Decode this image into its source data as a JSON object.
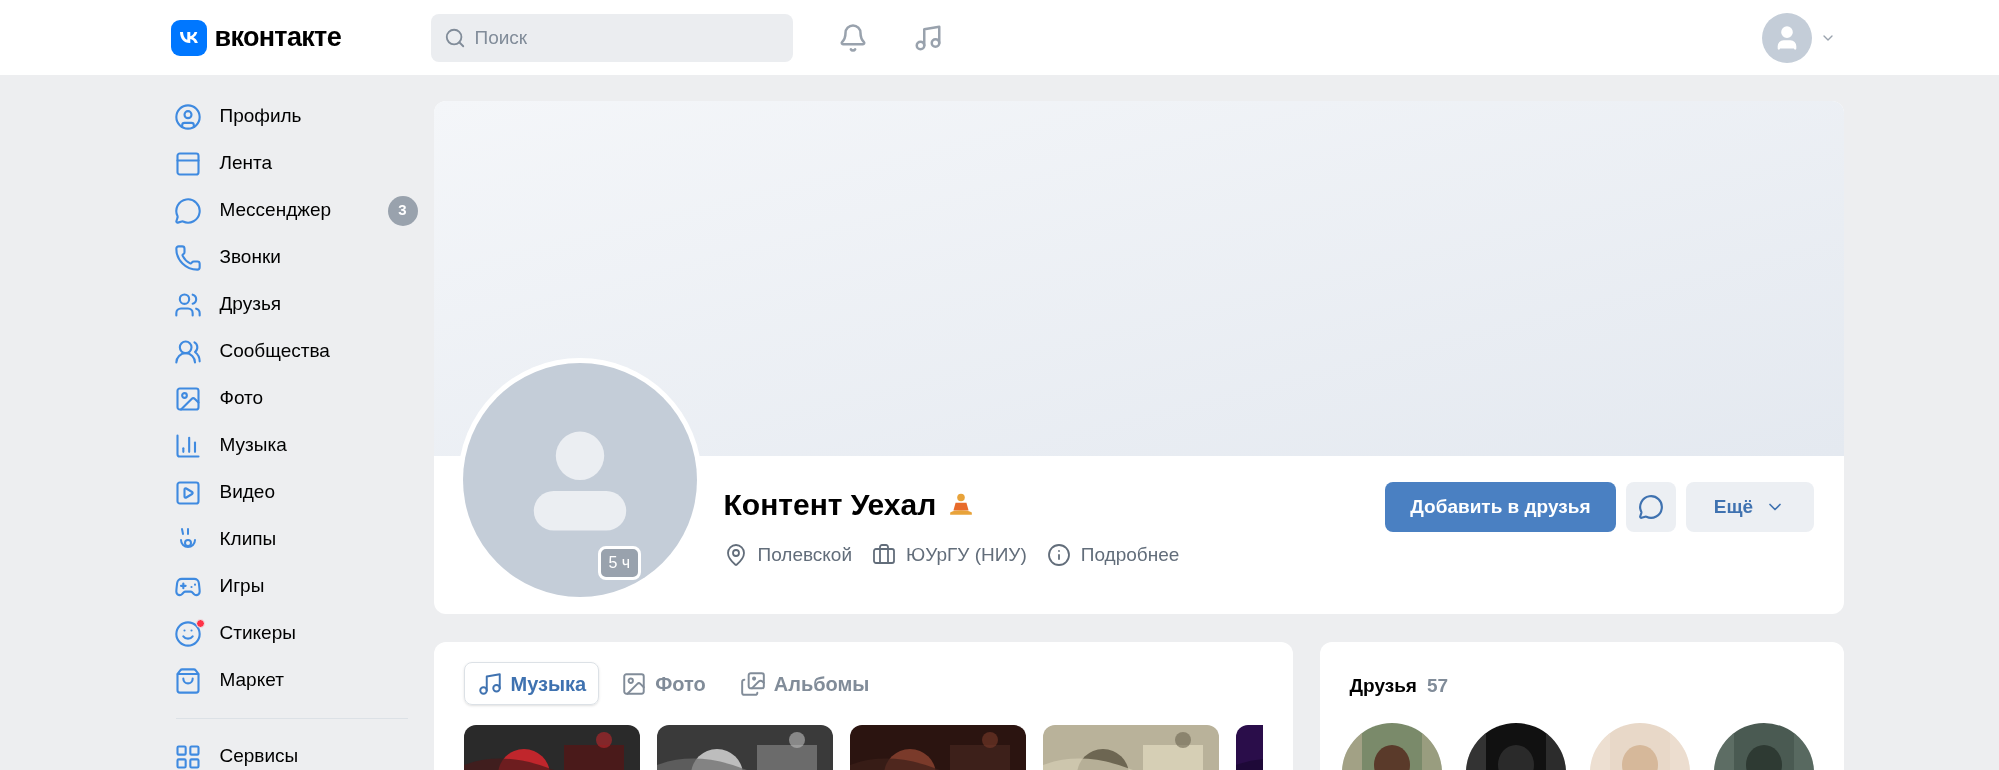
{
  "header": {
    "logo_text": "вконтакте",
    "search": {
      "placeholder": "Поиск"
    }
  },
  "sidebar": {
    "items": [
      {
        "label": "Профиль",
        "notification": false
      },
      {
        "label": "Лента",
        "notification": false
      },
      {
        "label": "Мессенджер",
        "badge": "3",
        "notification": false
      },
      {
        "label": "Звонки",
        "notification": false
      },
      {
        "label": "Друзья",
        "notification": false
      },
      {
        "label": "Сообщества",
        "notification": false
      },
      {
        "label": "Фото",
        "notification": false
      },
      {
        "label": "Музыка",
        "notification": false
      },
      {
        "label": "Видео",
        "notification": false
      },
      {
        "label": "Клипы",
        "notification": false
      },
      {
        "label": "Игры",
        "notification": false
      },
      {
        "label": "Стикеры",
        "notification": true
      },
      {
        "label": "Маркет",
        "notification": false
      }
    ],
    "services": {
      "label": "Сервисы"
    }
  },
  "profile": {
    "last_seen": "5 ч",
    "name": "Контент Уехал",
    "details": [
      "Полевской",
      "ЮУрГУ (НИУ)",
      "Подробнее"
    ],
    "add_friend": "Добавить в друзья",
    "more": "Ещё"
  },
  "media": {
    "tabs": [
      {
        "label": "Музыка",
        "selected": true
      },
      {
        "label": "Фото",
        "selected": false
      },
      {
        "label": "Альбомы",
        "selected": false
      }
    ]
  },
  "friends": {
    "title": "Друзья",
    "count": "57"
  }
}
